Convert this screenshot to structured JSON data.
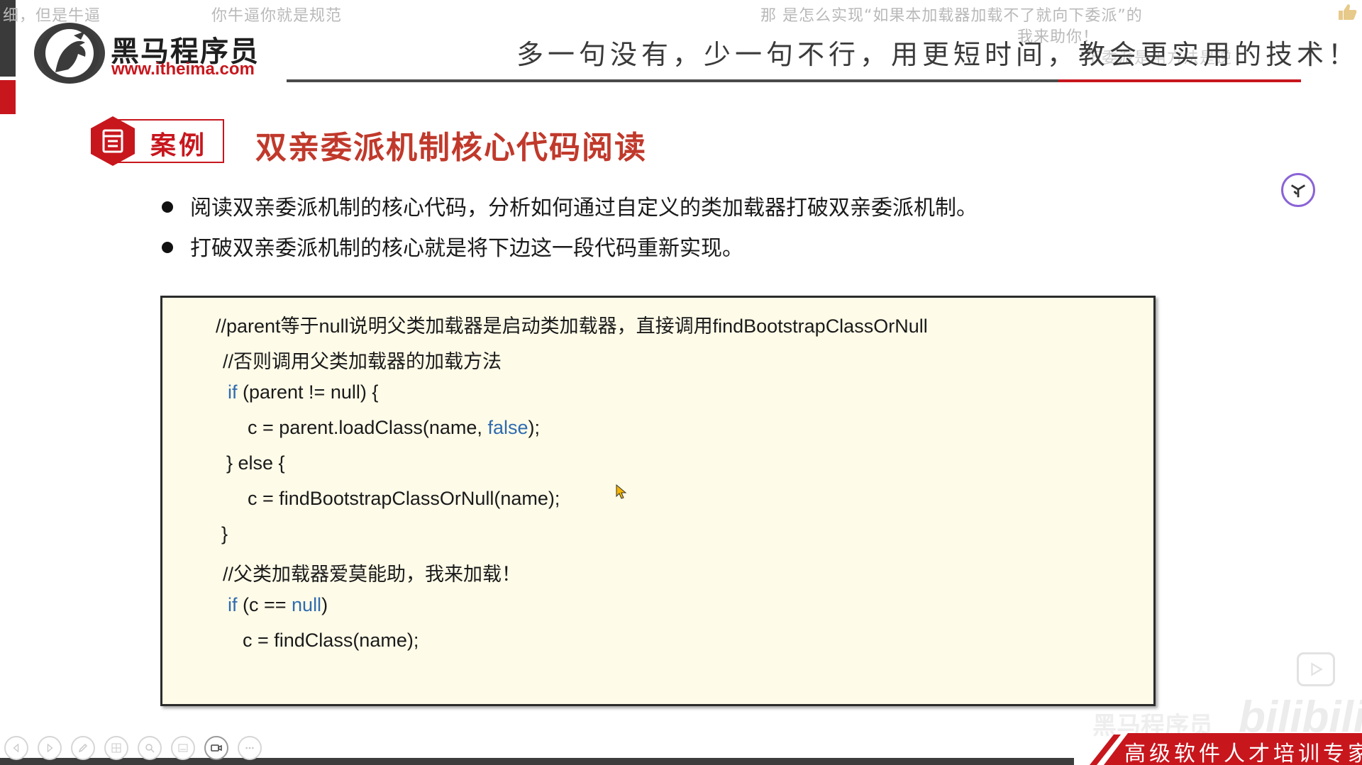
{
  "danmaku": [
    "细，但是牛逼",
    "你牛逼你就是规范",
    "那 是怎么实现“如果本加载器加载不了就向下委派”的",
    "我来助你！",
    "下委派是用方法是逆"
  ],
  "header": {
    "logo_cn": "黑马程序员",
    "logo_url": "www.itheima.com",
    "slogan": "多一句没有，少一句不行，用更短时间，教会更实用的技术！"
  },
  "section": {
    "case_label": "案例",
    "title": "双亲委派机制核心代码阅读"
  },
  "bullets": [
    "阅读双亲委派机制的核心代码，分析如何通过自定义的类加载器打破双亲委派机制。",
    "打破双亲委派机制的核心就是将下边这一段代码重新实现。"
  ],
  "code": {
    "line1": "//parent等于null说明父类加载器是启动类加载器，直接调用findBootstrapClassOrNull",
    "line2": "//否则调用父类加载器的加载方法",
    "line3_kw": "if",
    "line3_rest": " (parent != null) {",
    "line4_pre": "c = parent.loadClass(name, ",
    "line4_kw": "false",
    "line4_post": ");",
    "line5": "} else {",
    "line6": "c = findBootstrapClassOrNull(name);",
    "line7": "}",
    "line8": "//父类加载器爱莫能助，我来加载！",
    "line9_kw": "if",
    "line9_mid": " (c == ",
    "line9_kw2": "null",
    "line9_post": ")",
    "line10": "c = findClass(name);"
  },
  "watermark": {
    "cn": "黑马程序员",
    "bili": "bilibili"
  },
  "banner": {
    "text": "高级软件人才培训专家"
  },
  "toolbar": {
    "buttons": [
      "prev",
      "next",
      "pen",
      "grid",
      "zoom",
      "subtitle",
      "camera",
      "more"
    ]
  },
  "colors": {
    "brand_red": "#c8161d",
    "code_bg": "#fefbe8",
    "keyword_blue": "#2f6bb0"
  },
  "icons": [
    "horse-logo-icon",
    "document-icon",
    "circle-logo-icon",
    "play-icon",
    "cursor-icon"
  ]
}
